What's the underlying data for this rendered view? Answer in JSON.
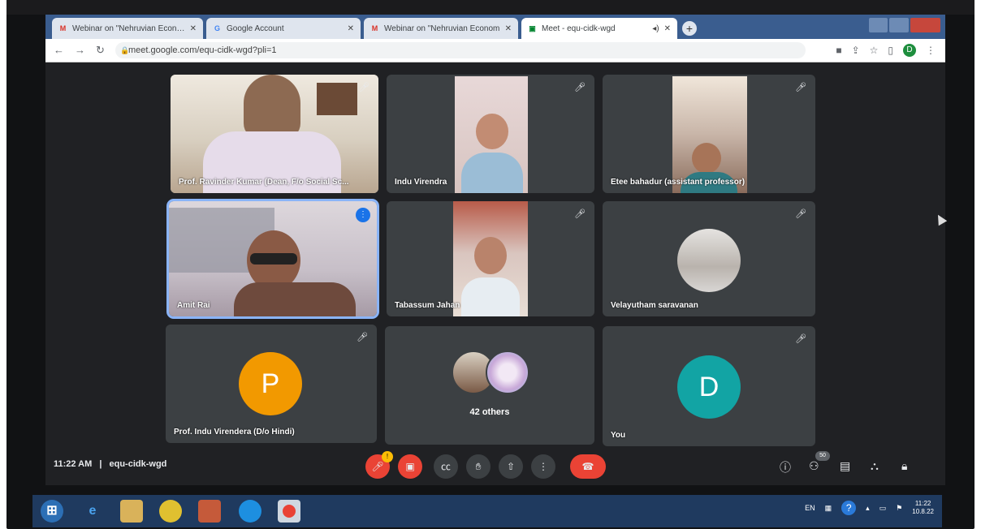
{
  "browser": {
    "tabs": [
      {
        "title": "Webinar on \"Nehruvian Econom",
        "favicon": "gmail-icon"
      },
      {
        "title": "Google Account",
        "favicon": "google-icon"
      },
      {
        "title": "Webinar on \"Nehruvian Econom",
        "favicon": "gmail-icon"
      },
      {
        "title": "Meet - equ-cidk-wgd",
        "favicon": "meet-icon"
      }
    ],
    "url": "meet.google.com/equ-cidk-wgd?pli=1",
    "profile_initial": "D"
  },
  "participants": [
    {
      "name": "Prof. Ravinder Kumar (Dean, F/o Social Sc...",
      "muted": true
    },
    {
      "name": "Indu Virendra",
      "muted": true
    },
    {
      "name": "Etee bahadur (assistant professor)",
      "muted": true
    },
    {
      "name": "Amit Rai",
      "speaking": true
    },
    {
      "name": "Tabassum Jahan",
      "muted": true
    },
    {
      "name": "Velayutham saravanan",
      "muted": true
    },
    {
      "name": "Prof. Indu Virendera (D/o Hindi)",
      "initial": "P",
      "avatar_color": "#f29900",
      "muted": true
    },
    {
      "name": "42 others"
    },
    {
      "name": "You",
      "initial": "D",
      "avatar_color": "#12a4a4",
      "muted": true
    }
  ],
  "meeting": {
    "time": "11:22 AM",
    "separator": "|",
    "code": "equ-cidk-wgd",
    "participant_count": "50",
    "mic_badge": "!"
  },
  "taskbar": {
    "language": "EN",
    "clock_time": "11:22",
    "clock_date": "10.8.22"
  },
  "colors": {
    "meet_bg": "#202124",
    "tile_bg": "#3c4043",
    "danger": "#ea4335",
    "speaking_outline": "#8ab4f8"
  }
}
